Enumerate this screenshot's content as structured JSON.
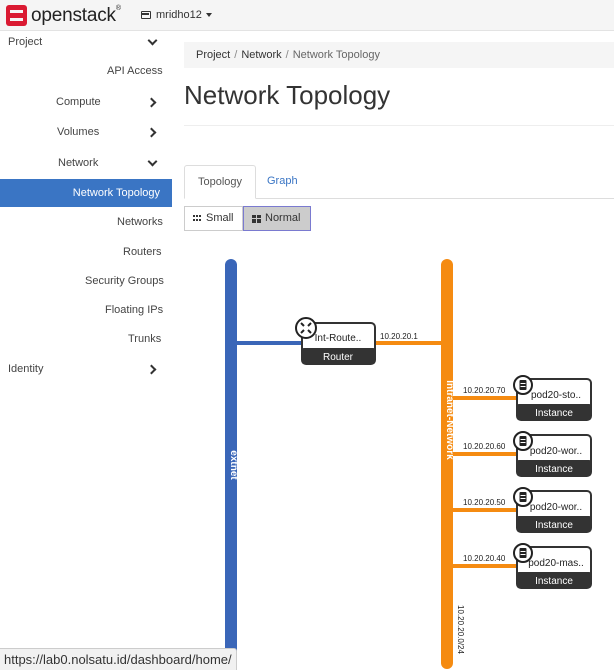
{
  "header": {
    "brand": "openstack",
    "brand_mark": "®",
    "user": "mridho12"
  },
  "sidebar": {
    "project": "Project",
    "api_access": "API Access",
    "compute": "Compute",
    "volumes": "Volumes",
    "network": "Network",
    "network_topology": "Network Topology",
    "networks": "Networks",
    "routers": "Routers",
    "security_groups": "Security Groups",
    "floating_ips": "Floating IPs",
    "trunks": "Trunks",
    "identity": "Identity"
  },
  "breadcrumb": {
    "project": "Project",
    "network": "Network",
    "current": "Network Topology",
    "separator": "/"
  },
  "page": {
    "title": "Network Topology"
  },
  "tabs": {
    "topology": "Topology",
    "graph": "Graph"
  },
  "toolbar": {
    "small": "Small",
    "normal": "Normal"
  },
  "topology": {
    "colors": {
      "extnet": "#3a66b8",
      "intranet": "#f58b11",
      "node_dark": "#333333"
    },
    "external_network": "extnet",
    "internal_network": "Intranet-Network",
    "internal_cidr": "10.20.20.0/24",
    "router": {
      "name": "Int-Route..",
      "type": "Router",
      "ip": "10.20.20.1"
    },
    "instances": [
      {
        "name": "pod20-sto..",
        "type": "Instance",
        "ip": "10.20.20.70"
      },
      {
        "name": "pod20-wor..",
        "type": "Instance",
        "ip": "10.20.20.60"
      },
      {
        "name": "pod20-wor..",
        "type": "Instance",
        "ip": "10.20.20.50"
      },
      {
        "name": "pod20-mas..",
        "type": "Instance",
        "ip": "10.20.20.40"
      }
    ]
  },
  "statusbar": {
    "url": "https://lab0.nolsatu.id/dashboard/home/"
  }
}
